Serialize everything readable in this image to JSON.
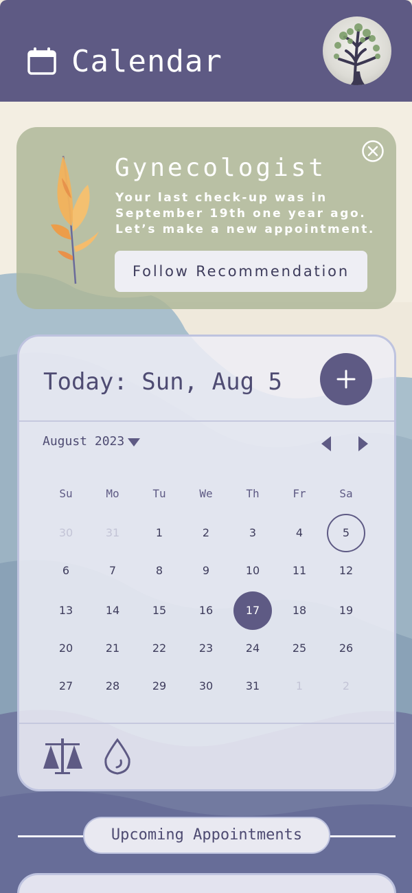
{
  "header": {
    "title": "Calendar",
    "background": "#5e5a84"
  },
  "recommendation": {
    "title": "Gynecologist",
    "text_lines": [
      "Your last check-up was in",
      "September 19th one year ago.",
      "Let’s make a new appointment."
    ],
    "button_label": "Follow Recommendation",
    "background": "#acb696"
  },
  "calendar": {
    "today_label": "Today: Sun, Aug 5",
    "month_label": "August 2023",
    "weekdays": [
      "Su",
      "Mo",
      "Tu",
      "We",
      "Th",
      "Fr",
      "Sa"
    ],
    "weeks": [
      [
        "30",
        "31",
        "1",
        "2",
        "3",
        "4",
        "5"
      ],
      [
        "6",
        "7",
        "8",
        "9",
        "10",
        "11",
        "12"
      ],
      [
        "13",
        "14",
        "15",
        "16",
        "17",
        "18",
        "19"
      ],
      [
        "20",
        "21",
        "22",
        "23",
        "24",
        "25",
        "26"
      ],
      [
        "27",
        "28",
        "29",
        "30",
        "31",
        "1",
        "2"
      ]
    ],
    "muted_cells": [
      [
        0,
        0
      ],
      [
        0,
        1
      ],
      [
        4,
        5
      ],
      [
        4,
        6
      ]
    ],
    "today_cell": [
      0,
      6
    ],
    "selected_cell": [
      2,
      4
    ],
    "accent": "#5e5a84"
  },
  "icons": {
    "header": "calendar-icon",
    "avatar": "tree-icon",
    "close": "close-circle-icon",
    "add": "plus-icon",
    "caret": "caret-down-icon",
    "prev": "caret-left-icon",
    "next": "caret-right-icon",
    "tools": [
      "scale-icon",
      "drop-icon"
    ]
  },
  "upcoming": {
    "label": "Upcoming Appointments"
  }
}
